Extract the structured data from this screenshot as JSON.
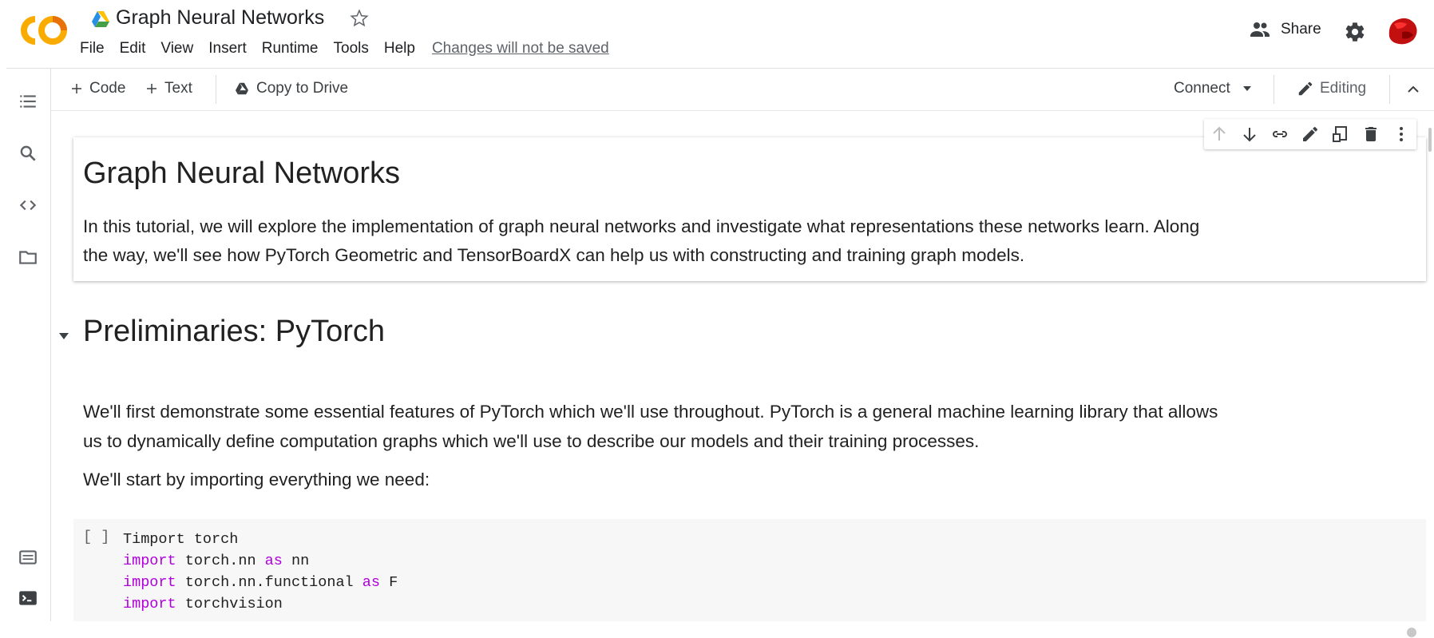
{
  "app": {
    "logo_text": "CO",
    "brand_colors": {
      "orange": "#F9AB00",
      "dark_orange": "#E8710A"
    }
  },
  "header": {
    "title": "Graph Neural Networks",
    "menu": [
      "File",
      "Edit",
      "View",
      "Insert",
      "Runtime",
      "Tools",
      "Help"
    ],
    "unsaved_notice": "Changes will not be saved",
    "share_label": "Share"
  },
  "toolbar": {
    "add_code_label": "Code",
    "add_text_label": "Text",
    "copy_to_drive_label": "Copy to Drive",
    "connect_label": "Connect",
    "editing_label": "Editing"
  },
  "rail_icons": [
    "table-of-contents-icon",
    "search-icon",
    "code-snippets-icon",
    "files-icon",
    "command-palette-icon",
    "terminal-icon"
  ],
  "cell_toolbar_icons": [
    "move-up-icon",
    "move-down-icon",
    "link-icon",
    "edit-icon",
    "mirror-cell-icon",
    "delete-icon",
    "more-vert-icon"
  ],
  "notebook": {
    "intro": {
      "heading": "Graph Neural Networks",
      "line1": "In this tutorial, we will explore the implementation of graph neural networks and investigate what representations these networks learn. Along",
      "line2": "the way, we'll see how PyTorch Geometric and TensorBoardX can help us with constructing and training graph models."
    },
    "section": {
      "heading": "Preliminaries: PyTorch",
      "para1_line1": "We'll first demonstrate some essential features of PyTorch which we'll use throughout. PyTorch is a general machine learning library that allows",
      "para1_line2": "us to dynamically define computation graphs which we'll use to describe our models and their training processes.",
      "para2": "We'll start by importing everything we need:"
    },
    "code_cell": {
      "run_indicator": "[ ]",
      "lines": [
        {
          "kw": "Timport",
          "rest": " torch",
          "kw_colored": false
        },
        {
          "kw": "import",
          "rest": " torch.nn ",
          "kw2": "as",
          "rest2": " nn"
        },
        {
          "kw": "import",
          "rest": " torch.nn.functional ",
          "kw2": "as",
          "rest2": " F"
        },
        {
          "kw": "import",
          "rest": " torchvision",
          "kw2": "",
          "rest2": ""
        }
      ]
    }
  }
}
